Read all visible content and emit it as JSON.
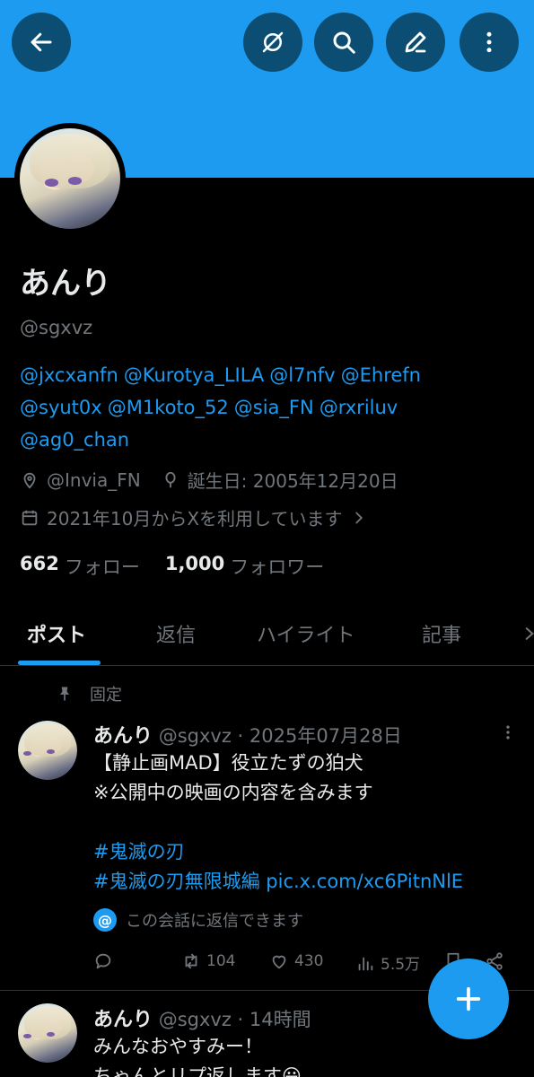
{
  "header": {
    "back_icon": "arrow-left-icon",
    "grok_icon": "grok-icon",
    "search_icon": "search-icon",
    "edit_icon": "pencil-icon",
    "more_icon": "more-vertical-icon"
  },
  "profile": {
    "name": "あんり",
    "handle": "@sgxvz",
    "bio_mentions": [
      "@jxcxanfn",
      "@Kurotya_LILA",
      "@l7nfv",
      "@Ehrefn",
      "@syut0x",
      "@M1koto_52",
      "@sia_FN",
      "@rxriluv",
      "@ag0_chan"
    ],
    "location": "@Invia_FN",
    "birthday": "誕生日: 2005年12月20日",
    "joined": "2021年10月からXを利用しています",
    "following_count": "662",
    "following_label": "フォロー",
    "followers_count": "1,000",
    "followers_label": "フォロワー"
  },
  "tabs": [
    {
      "label": "ポスト",
      "active": true
    },
    {
      "label": "返信",
      "active": false
    },
    {
      "label": "ハイライト",
      "active": false
    },
    {
      "label": "記事",
      "active": false
    }
  ],
  "pinned_label": "固定",
  "posts": [
    {
      "name": "あんり",
      "handle": "@sgxvz",
      "dot": "·",
      "time": "2025年07月28日",
      "lines": [
        "【静止画MAD】役立たずの狛犬",
        "※公開中の映画の内容を含みます"
      ],
      "hashtag1": "#鬼滅の刃",
      "hashtag2": "#鬼滅の刃無限城編",
      "pic_link": "pic.x.com/xc6PitnNlE",
      "reply_note": "この会話に返信できます",
      "retweets": "104",
      "likes": "430",
      "views": "5.5万"
    },
    {
      "name": "あんり",
      "handle": "@sgxvz",
      "dot": "·",
      "time": "14時間",
      "lines": [
        "みんなおやすみー！",
        "ちゃんとリプ返します😀"
      ]
    }
  ],
  "colors": {
    "accent": "#1d9bf0",
    "background": "#000000",
    "muted_text": "#71767b",
    "primary_text": "#e7e9ea"
  }
}
